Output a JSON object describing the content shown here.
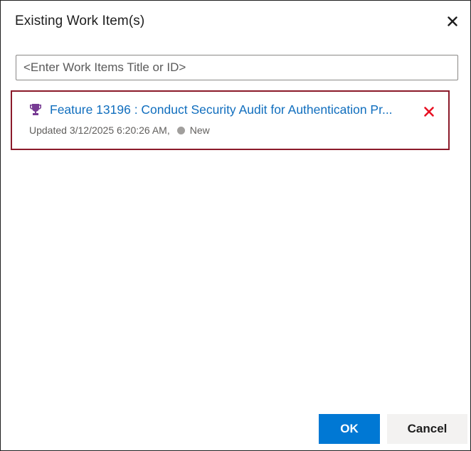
{
  "dialog": {
    "title": "Existing Work Item(s)",
    "close_icon": "close-icon"
  },
  "search": {
    "placeholder": "<Enter Work Items Title or ID>",
    "value": ""
  },
  "results": [
    {
      "icon": "trophy-icon",
      "icon_color": "#773b93",
      "title": "Feature 13196 : Conduct Security Audit for Authentication Pr...",
      "updated": "Updated 3/12/2025 6:20:26 AM,",
      "state": "New",
      "state_color": "#a19f9d",
      "remove_icon": "remove-icon",
      "remove_color": "#e81123",
      "selected_border_color": "#8b1a2a"
    }
  ],
  "footer": {
    "ok_label": "OK",
    "cancel_label": "Cancel",
    "ok_color": "#0078d4"
  }
}
